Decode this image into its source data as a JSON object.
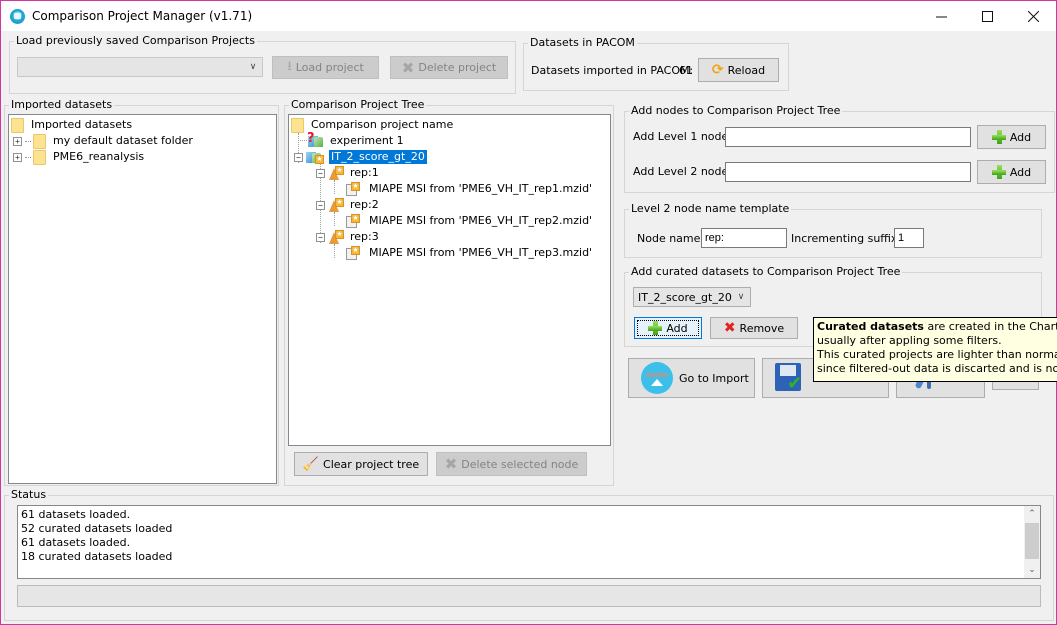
{
  "window": {
    "title": "Comparison Project Manager (v1.71)",
    "controls": {
      "minimize": "minimize-icon",
      "maximize": "maximize-icon",
      "close": "close-icon"
    }
  },
  "load_projects": {
    "legend": "Load previously saved Comparison Projects",
    "combo_value": "",
    "load_label": "Load project",
    "delete_label": "Delete project"
  },
  "pacom": {
    "legend": "Datasets in PACOM",
    "imported_label": "Datasets imported in PACOM:",
    "imported_count": "61",
    "reload_label": "Reload"
  },
  "imported_datasets": {
    "legend": "Imported datasets",
    "root": "Imported datasets",
    "children": [
      "my default dataset folder",
      "PME6_reanalysis"
    ]
  },
  "project_tree": {
    "legend": "Comparison Project Tree",
    "root": "Comparison project name",
    "experiment1": "experiment 1",
    "curated": "IT_2_score_gt_20",
    "reps": [
      {
        "label": "rep:1",
        "child": "MIAPE MSI from 'PME6_VH_IT_rep1.mzid'"
      },
      {
        "label": "rep:2",
        "child": "MIAPE MSI from 'PME6_VH_IT_rep2.mzid'"
      },
      {
        "label": "rep:3",
        "child": "MIAPE MSI from 'PME6_VH_IT_rep3.mzid'"
      }
    ],
    "clear_label": "Clear project tree",
    "delete_node_label": "Delete selected node"
  },
  "add_nodes": {
    "legend": "Add nodes to Comparison Project Tree",
    "level1_label": "Add Level 1 node:",
    "level1_value": "",
    "level2_label": "Add Level 2 node:",
    "level2_value": "",
    "add_label": "Add"
  },
  "template": {
    "legend": "Level 2 node name template",
    "node_name_label": "Node name:",
    "node_name_value": "rep:",
    "suffix_label": "Incrementing suffix:",
    "suffix_value": "1"
  },
  "curated": {
    "legend": "Add curated datasets to Comparison Project Tree",
    "selected": "IT_2_score_gt_20",
    "add_label": "Add",
    "remove_label": "Remove"
  },
  "actions": {
    "go_to_import_label": "Go to Import"
  },
  "tooltip": {
    "bold": "Curated datasets",
    "line1_rest": " are created in the Chart View",
    "line2": "usually after appling some filters.",
    "line3": "This curated projects are lighter than normal projects",
    "line4": "since filtered-out data is discarted and is not loaded"
  },
  "status": {
    "legend": "Status",
    "lines": [
      "61 datasets loaded.",
      "52 curated datasets loaded",
      "61 datasets loaded.",
      "18 curated datasets loaded"
    ]
  }
}
